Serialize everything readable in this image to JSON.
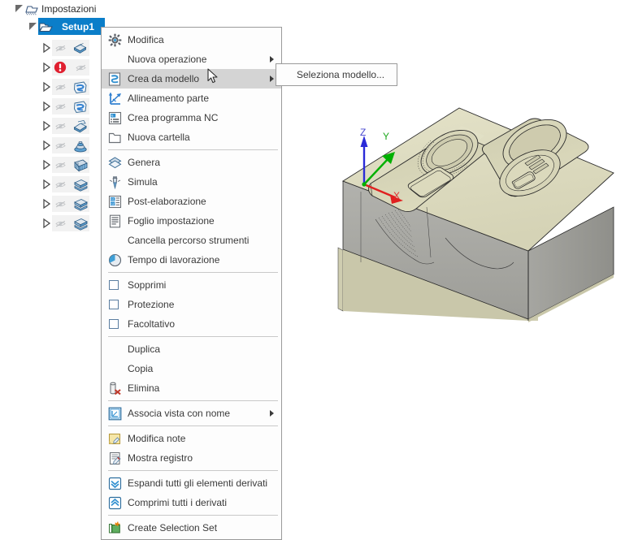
{
  "tree": {
    "root": {
      "label": "Impostazioni",
      "icon": "setup-folder-dashed-icon",
      "expanded": true
    },
    "setup": {
      "label": "Setup1",
      "icon": "folder-open-icon",
      "expanded": true,
      "selected": true,
      "selection_color": "#0b7ec9"
    },
    "operations": [
      {
        "icon": "face-milling-icon",
        "visibility_icon": "eye-slash-icon",
        "status": "ok",
        "expanded": false
      },
      {
        "icon": "error-icon",
        "visibility_icon": "eye-slash-icon",
        "status": "error",
        "expanded": false
      },
      {
        "icon": "adaptive-clear-icon",
        "visibility_icon": "eye-slash-icon",
        "status": "ok",
        "expanded": false
      },
      {
        "icon": "adaptive-clear-icon",
        "visibility_icon": "eye-slash-icon",
        "status": "ok",
        "expanded": false
      },
      {
        "icon": "pocket-icon",
        "visibility_icon": "eye-slash-icon",
        "status": "ok",
        "expanded": false
      },
      {
        "icon": "contour-ramp-icon",
        "visibility_icon": "eye-slash-icon",
        "status": "ok",
        "expanded": false
      },
      {
        "icon": "parallel-finish-icon",
        "visibility_icon": "eye-slash-icon",
        "status": "ok",
        "expanded": false
      },
      {
        "icon": "flat-finish-icon",
        "visibility_icon": "eye-slash-icon",
        "status": "ok",
        "expanded": false
      },
      {
        "icon": "flat-finish-icon",
        "visibility_icon": "eye-slash-icon",
        "status": "ok",
        "expanded": false
      },
      {
        "icon": "flat-finish-icon",
        "visibility_icon": "eye-slash-icon",
        "status": "ok",
        "expanded": false
      }
    ]
  },
  "context_menu": {
    "items": [
      {
        "label": "Modifica",
        "icon": "gear-icon",
        "type": "item"
      },
      {
        "label": "Nuova operazione",
        "icon": "",
        "type": "submenu"
      },
      {
        "label": "Crea da modello",
        "icon": "template-icon",
        "type": "submenu",
        "highlighted": true
      },
      {
        "label": "Allineamento parte",
        "icon": "part-alignment-icon",
        "type": "item"
      },
      {
        "label": "Crea programma NC",
        "icon": "nc-program-icon",
        "type": "item"
      },
      {
        "label": "Nuova cartella",
        "icon": "new-folder-icon",
        "type": "item"
      },
      {
        "type": "separator"
      },
      {
        "label": "Genera",
        "icon": "generate-icon",
        "type": "item"
      },
      {
        "label": "Simula",
        "icon": "simulate-icon",
        "type": "item"
      },
      {
        "label": "Post-elaborazione",
        "icon": "post-process-icon",
        "type": "item"
      },
      {
        "label": "Foglio impostazione",
        "icon": "setup-sheet-icon",
        "type": "item"
      },
      {
        "label": "Cancella percorso strumenti",
        "icon": "",
        "type": "item"
      },
      {
        "label": "Tempo di lavorazione",
        "icon": "machining-time-icon",
        "type": "item"
      },
      {
        "type": "separator"
      },
      {
        "label": "Sopprimi",
        "icon": "checkbox",
        "type": "checkbox",
        "checked": false
      },
      {
        "label": "Protezione",
        "icon": "checkbox",
        "type": "checkbox",
        "checked": false
      },
      {
        "label": "Facoltativo",
        "icon": "checkbox",
        "type": "checkbox",
        "checked": false
      },
      {
        "type": "separator"
      },
      {
        "label": "Duplica",
        "icon": "",
        "type": "item"
      },
      {
        "label": "Copia",
        "icon": "",
        "type": "item"
      },
      {
        "label": "Elimina",
        "icon": "delete-icon",
        "type": "item"
      },
      {
        "type": "separator"
      },
      {
        "label": "Associa vista con nome",
        "icon": "named-view-icon",
        "type": "submenu"
      },
      {
        "type": "separator"
      },
      {
        "label": "Modifica note",
        "icon": "edit-note-icon",
        "type": "item"
      },
      {
        "label": "Mostra registro",
        "icon": "show-log-icon",
        "type": "item"
      },
      {
        "type": "separator"
      },
      {
        "label": "Espandi tutti gli elementi derivati",
        "icon": "expand-all-icon",
        "type": "item"
      },
      {
        "label": "Comprimi tutti i derivati",
        "icon": "collapse-all-icon",
        "type": "item"
      },
      {
        "type": "separator"
      },
      {
        "label": "Create Selection Set",
        "icon": "selection-set-icon",
        "type": "item"
      }
    ]
  },
  "submenu": {
    "items": [
      {
        "label": "Seleziona modello...",
        "type": "item"
      }
    ]
  },
  "viewport": {
    "axes": {
      "z_label": "Z",
      "y_label": "Y",
      "x_label": "X",
      "z_color": "#2b2bd8",
      "y_color": "#00b000",
      "x_color": "#e02020"
    },
    "model": {
      "description": "machined-block",
      "top_face_color": "#dedcc0",
      "side_face_color": "#a9a9a5",
      "edge_color": "#2a2a2a"
    }
  },
  "cursor": {
    "icon": "mouse-pointer-icon"
  }
}
